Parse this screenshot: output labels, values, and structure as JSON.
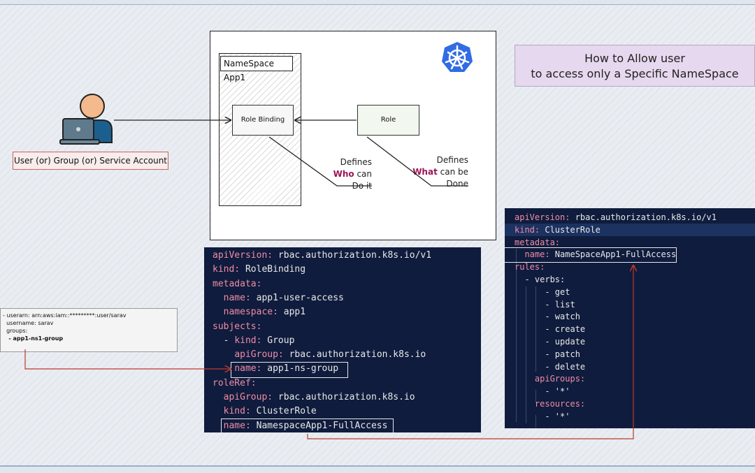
{
  "title": {
    "line1": "How to Allow user",
    "line2": "to access only a Specific NameSpace"
  },
  "user_label": "User (or) Group (or) Service Account",
  "diagram": {
    "namespace_title": "NameSpace App1",
    "role_binding_label": "Role Binding",
    "role_label": "Role",
    "defines_who": {
      "line1": "Defines",
      "highlight": "Who",
      "rest": " can",
      "line3": "Do it"
    },
    "defines_what": {
      "line1": "Defines",
      "highlight": "What",
      "rest": " can be",
      "line3": "Done"
    }
  },
  "identity": {
    "line1": "- userarn: arn:aws:iam::*********:user/sarav",
    "line2": "  username: sarav",
    "line3": "  groups:",
    "line4": "   - app1-ns1-group"
  },
  "code_left": [
    {
      "k": "apiVersion",
      "v": " rbac.authorization.k8s.io/v1",
      "indent": ""
    },
    {
      "k": "kind",
      "v": " RoleBinding",
      "indent": ""
    },
    {
      "k": "metadata",
      "v": "",
      "indent": ""
    },
    {
      "k": "name",
      "v": " app1-user-access",
      "indent": "  "
    },
    {
      "k": "namespace",
      "v": " app1",
      "indent": "  "
    },
    {
      "k": "subjects",
      "v": "",
      "indent": ""
    },
    {
      "k": "kind",
      "v": " Group",
      "indent": "  - "
    },
    {
      "k": "apiGroup",
      "v": " rbac.authorization.k8s.io",
      "indent": "    "
    },
    {
      "k": "name",
      "v": " app1-ns-group",
      "indent": "    "
    },
    {
      "k": "roleRef",
      "v": "",
      "indent": ""
    },
    {
      "k": "apiGroup",
      "v": " rbac.authorization.k8s.io",
      "indent": "  "
    },
    {
      "k": "kind",
      "v": " ClusterRole",
      "indent": "  "
    },
    {
      "k": "name",
      "v": " NamespaceApp1-FullAccess",
      "indent": "  "
    }
  ],
  "code_right": [
    {
      "k": "apiVersion",
      "v": " rbac.authorization.k8s.io/v1",
      "indent": ""
    },
    {
      "k": "kind",
      "v": " ClusterRole",
      "indent": ""
    },
    {
      "k": "metadata",
      "v": "",
      "indent": ""
    },
    {
      "k": "name",
      "v": " NameSpaceApp1-FullAccess",
      "indent": "  "
    },
    {
      "k": "rules",
      "v": "",
      "indent": ""
    },
    {
      "k": "",
      "v": "- verbs:",
      "indent": "  "
    },
    {
      "k": "",
      "v": "- get",
      "indent": "      "
    },
    {
      "k": "",
      "v": "- list",
      "indent": "      "
    },
    {
      "k": "",
      "v": "- watch",
      "indent": "      "
    },
    {
      "k": "",
      "v": "- create",
      "indent": "      "
    },
    {
      "k": "",
      "v": "- update",
      "indent": "      "
    },
    {
      "k": "",
      "v": "- patch",
      "indent": "      "
    },
    {
      "k": "",
      "v": "- delete",
      "indent": "      "
    },
    {
      "k": "apiGroups",
      "v": "",
      "indent": "    "
    },
    {
      "k": "",
      "v": "- '*'",
      "indent": "      "
    },
    {
      "k": "resources",
      "v": "",
      "indent": "    "
    },
    {
      "k": "",
      "v": "- '*'",
      "indent": "      "
    }
  ],
  "colors": {
    "code_bg": "#0f1c3d",
    "key": "#f08ca6",
    "connector_red": "#c0392b",
    "title_bg": "#e6d8ee",
    "highlight_word": "#9b1557",
    "k8s_blue": "#326ce5"
  }
}
